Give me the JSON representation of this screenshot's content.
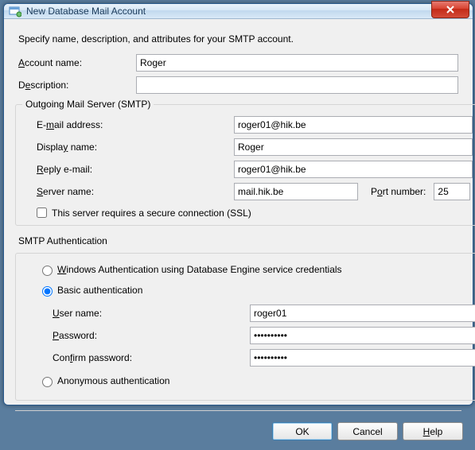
{
  "window": {
    "title": "New Database Mail Account"
  },
  "instruction": "Specify name, description, and attributes for your SMTP account.",
  "labels": {
    "account_name_pre": "",
    "account_name_u": "A",
    "account_name_post": "ccount name:",
    "description_pre": "D",
    "description_u": "e",
    "description_post": "scription:"
  },
  "account": {
    "name": "Roger",
    "description": ""
  },
  "smtp": {
    "legend": "Outgoing Mail Server (SMTP)",
    "email_label_pre": "E-",
    "email_label_u": "m",
    "email_label_post": "ail address:",
    "email": "roger01@hik.be",
    "display_label_pre": "Displa",
    "display_label_u": "y",
    "display_label_post": " name:",
    "display_name": "Roger",
    "reply_label_pre": "",
    "reply_label_u": "R",
    "reply_label_post": "eply e-mail:",
    "reply": "roger01@hik.be",
    "server_label_pre": "",
    "server_label_u": "S",
    "server_label_post": "erver name:",
    "server": "mail.hik.be",
    "port_label_pre": "P",
    "port_label_u": "o",
    "port_label_post": "rt number:",
    "port": "25",
    "ssl_label_pre": "This server requires a secure connection (SSL)"
  },
  "auth": {
    "header": "SMTP Authentication",
    "win_label_pre": "",
    "win_label_u": "W",
    "win_label_post": "indows Authentication using Database Engine service credentials",
    "basic_label": "Basic authentication",
    "user_label_pre": "",
    "user_label_u": "U",
    "user_label_post": "ser name:",
    "user": "roger01",
    "pass_label_pre": "",
    "pass_label_u": "P",
    "pass_label_post": "assword:",
    "pass": "**********",
    "confirm_label_pre": "Con",
    "confirm_label_u": "f",
    "confirm_label_post": "irm password:",
    "confirm": "**********",
    "anon_label": "Anonymous authentication"
  },
  "buttons": {
    "ok": "OK",
    "cancel": "Cancel",
    "help_u": "H",
    "help_post": "elp"
  }
}
